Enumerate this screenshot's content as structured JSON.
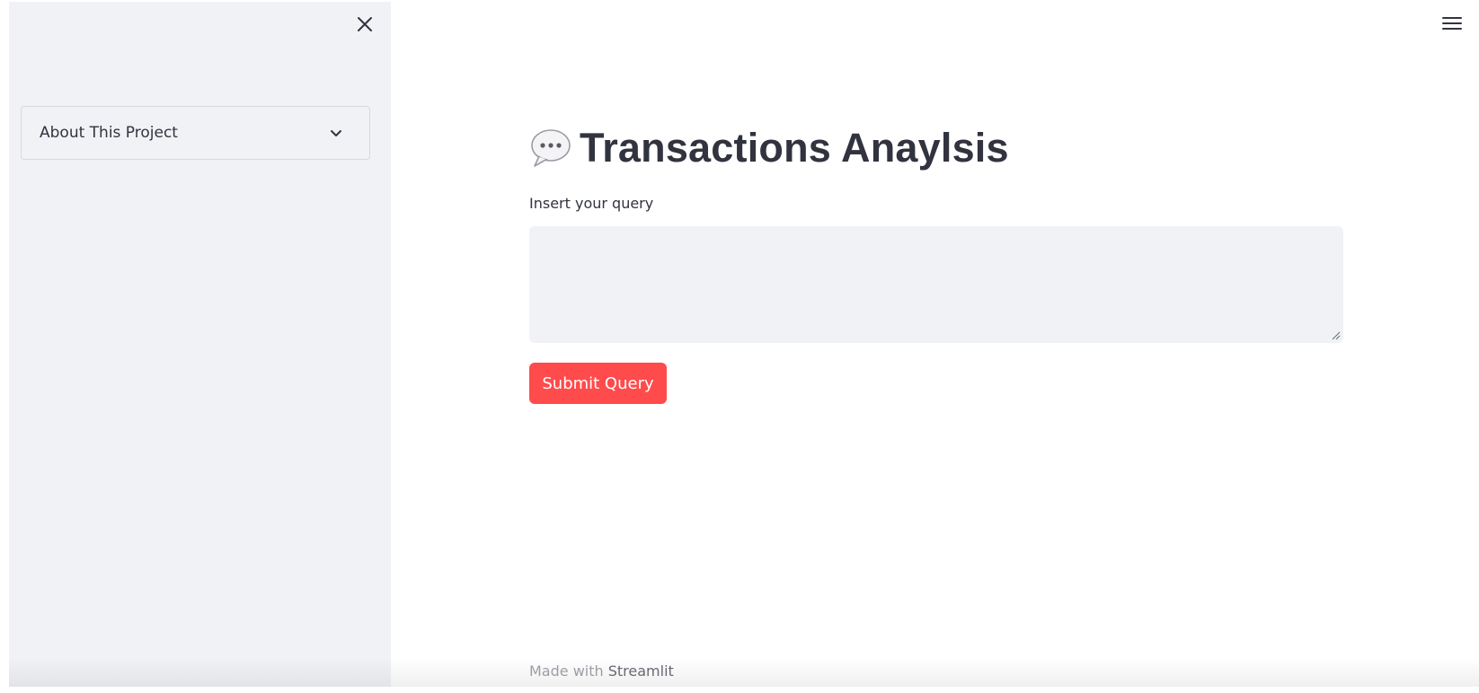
{
  "sidebar": {
    "close_icon": "close-icon",
    "expander": {
      "label": "About This Project",
      "icon": "chevron-down-icon"
    }
  },
  "header": {
    "menu_icon": "hamburger-menu-icon"
  },
  "main": {
    "title_icon": "speech-bubble-icon",
    "title": "Transactions Anaylsis",
    "input_label": "Insert your query",
    "query_value": "",
    "submit_label": "Submit Query"
  },
  "footer": {
    "made_with": "Made with",
    "link": "Streamlit"
  },
  "colors": {
    "accent": "#ff4b4b",
    "sidebar_bg": "#f0f2f6",
    "text": "#31333f"
  }
}
